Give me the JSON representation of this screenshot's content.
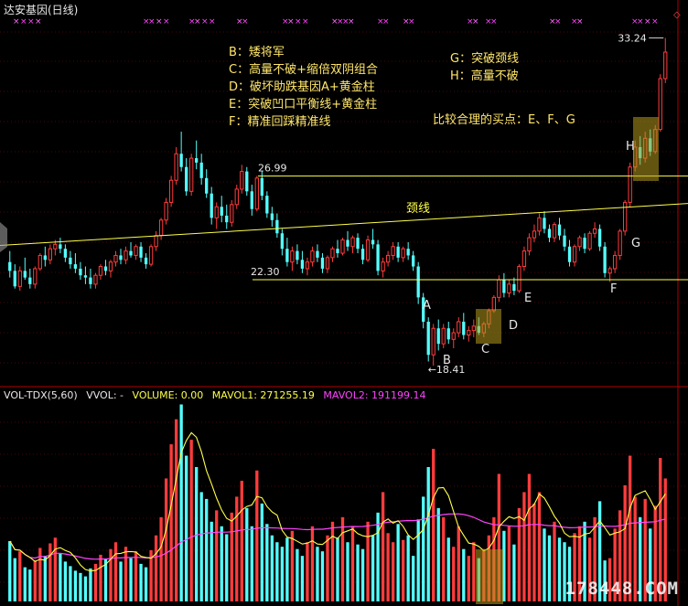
{
  "title": "达安基因(日线)",
  "legend": {
    "left": [
      "B：矮将军",
      "C：高量不破+缩倍双阴组合",
      "D：破坏助跌基因A+黄金柱",
      "E：突破凹口平衡线+黄金柱",
      "F：精准回踩精准线"
    ],
    "right": [
      "G：突破颈线",
      "H：高量不破"
    ],
    "conclusion": "比较合理的买点：E、F、G"
  },
  "volume_header": {
    "indicator": "VOL-TDX(5,60)",
    "vvol": "VVOL: -",
    "volume": "VOLUME: 0.00",
    "mavol1": "MAVOL1: 271255.19",
    "mavol2": "MAVOL2: 191199.14"
  },
  "watermark": "178448.COM",
  "colors": {
    "up": "#ff3c3c",
    "down": "#54ffff",
    "line_yellow": "#ffff4a",
    "ma_magenta": "#ff44ff",
    "grid": "#8a1010",
    "text": "#e8e8e8"
  },
  "chart_data": [
    {
      "type": "candlestick",
      "y_range": [
        18.41,
        33.24
      ],
      "price_labels": {
        "high": "33.24",
        "low": "←18.41"
      },
      "horizontal_lines": [
        {
          "label": "26.99",
          "value": 26.99
        },
        {
          "label": "22.30",
          "value": 22.3
        }
      ],
      "neckline": {
        "label": "颈线",
        "start_value": 23.85,
        "end_value": 25.75
      },
      "point_labels": [
        "A",
        "B",
        "C",
        "D",
        "E",
        "F",
        "G",
        "H"
      ],
      "candles": [
        [
          23.1,
          23.6,
          22.4,
          22.7
        ],
        [
          22.7,
          23.0,
          21.9,
          22.0
        ],
        [
          22.0,
          22.9,
          21.8,
          22.7
        ],
        [
          22.7,
          23.3,
          22.3,
          22.4
        ],
        [
          22.4,
          22.8,
          21.9,
          22.1
        ],
        [
          22.1,
          22.9,
          21.9,
          22.8
        ],
        [
          22.8,
          23.5,
          22.7,
          23.4
        ],
        [
          23.4,
          23.8,
          22.9,
          23.2
        ],
        [
          23.2,
          23.9,
          23.0,
          23.7
        ],
        [
          23.7,
          24.1,
          23.4,
          23.9
        ],
        [
          23.9,
          24.2,
          23.5,
          23.7
        ],
        [
          23.7,
          23.9,
          23.1,
          23.3
        ],
        [
          23.3,
          23.6,
          22.8,
          23.0
        ],
        [
          23.0,
          23.5,
          22.6,
          22.8
        ],
        [
          22.8,
          23.1,
          22.3,
          22.5
        ],
        [
          22.5,
          22.9,
          22.1,
          22.4
        ],
        [
          22.4,
          22.8,
          21.9,
          22.1
        ],
        [
          22.1,
          22.6,
          21.9,
          22.5
        ],
        [
          22.5,
          23.0,
          22.3,
          22.9
        ],
        [
          22.9,
          23.2,
          22.5,
          22.7
        ],
        [
          22.7,
          23.2,
          22.4,
          23.1
        ],
        [
          23.1,
          23.6,
          22.9,
          23.4
        ],
        [
          23.4,
          23.7,
          23.0,
          23.2
        ],
        [
          23.2,
          23.8,
          23.0,
          23.6
        ],
        [
          23.6,
          24.0,
          23.3,
          23.4
        ],
        [
          23.4,
          23.9,
          23.2,
          23.8
        ],
        [
          23.8,
          24.0,
          23.1,
          23.3
        ],
        [
          23.3,
          23.5,
          22.8,
          23.0
        ],
        [
          23.0,
          23.9,
          22.9,
          23.8
        ],
        [
          23.8,
          24.5,
          23.6,
          24.3
        ],
        [
          24.3,
          25.1,
          24.1,
          25.0
        ],
        [
          25.0,
          26.0,
          24.8,
          25.8
        ],
        [
          25.8,
          27.0,
          25.6,
          26.8
        ],
        [
          26.8,
          28.3,
          26.6,
          28.0
        ],
        [
          28.0,
          29.0,
          27.2,
          27.4
        ],
        [
          27.4,
          27.8,
          26.1,
          26.3
        ],
        [
          26.3,
          28.0,
          26.1,
          27.8
        ],
        [
          27.8,
          28.6,
          27.3,
          27.6
        ],
        [
          27.6,
          28.0,
          26.6,
          26.9
        ],
        [
          26.9,
          27.3,
          26.0,
          26.2
        ],
        [
          26.2,
          26.5,
          24.8,
          25.1
        ],
        [
          25.1,
          25.8,
          24.6,
          25.6
        ],
        [
          25.6,
          26.1,
          24.9,
          25.2
        ],
        [
          25.2,
          25.7,
          24.6,
          24.9
        ],
        [
          24.9,
          25.9,
          24.7,
          25.7
        ],
        [
          25.7,
          26.6,
          25.5,
          26.4
        ],
        [
          26.4,
          27.5,
          26.2,
          27.2
        ],
        [
          27.2,
          27.4,
          26.1,
          26.3
        ],
        [
          26.3,
          26.6,
          25.2,
          25.5
        ],
        [
          25.5,
          27.0,
          25.4,
          26.9
        ],
        [
          26.9,
          27.2,
          25.9,
          26.1
        ],
        [
          26.1,
          26.3,
          25.1,
          25.3
        ],
        [
          25.3,
          25.6,
          24.7,
          25.0
        ],
        [
          25.0,
          25.3,
          24.2,
          24.4
        ],
        [
          24.4,
          24.6,
          23.4,
          23.7
        ],
        [
          23.7,
          24.2,
          22.9,
          23.1
        ],
        [
          23.1,
          23.8,
          22.7,
          23.6
        ],
        [
          23.6,
          23.9,
          23.0,
          23.2
        ],
        [
          23.2,
          23.6,
          22.6,
          22.8
        ],
        [
          22.8,
          23.3,
          22.5,
          23.1
        ],
        [
          23.1,
          23.8,
          22.9,
          23.6
        ],
        [
          23.6,
          23.9,
          23.1,
          23.3
        ],
        [
          23.3,
          23.5,
          22.6,
          22.8
        ],
        [
          22.8,
          23.4,
          22.6,
          23.3
        ],
        [
          23.3,
          23.8,
          23.1,
          23.7
        ],
        [
          23.7,
          24.1,
          23.3,
          23.5
        ],
        [
          23.5,
          24.2,
          23.4,
          24.1
        ],
        [
          24.1,
          24.5,
          23.6,
          23.8
        ],
        [
          23.8,
          24.3,
          23.5,
          24.2
        ],
        [
          24.2,
          24.4,
          23.5,
          23.7
        ],
        [
          23.7,
          23.9,
          23.0,
          23.2
        ],
        [
          23.2,
          24.3,
          23.1,
          24.1
        ],
        [
          24.1,
          24.6,
          23.7,
          23.9
        ],
        [
          23.9,
          24.1,
          22.5,
          22.7
        ],
        [
          22.7,
          23.3,
          22.4,
          23.1
        ],
        [
          23.1,
          23.6,
          22.9,
          23.4
        ],
        [
          23.4,
          24.0,
          23.2,
          23.8
        ],
        [
          23.8,
          24.0,
          23.1,
          23.3
        ],
        [
          23.3,
          23.8,
          23.1,
          23.7
        ],
        [
          23.7,
          24.0,
          23.2,
          23.4
        ],
        [
          23.4,
          23.6,
          22.7,
          22.9
        ],
        [
          22.9,
          23.1,
          21.2,
          21.5
        ],
        [
          21.5,
          21.7,
          20.1,
          20.4
        ],
        [
          20.4,
          20.6,
          18.6,
          18.9
        ],
        [
          18.9,
          20.3,
          18.41,
          20.1
        ],
        [
          20.1,
          20.5,
          19.1,
          19.4
        ],
        [
          19.4,
          20.3,
          19.2,
          20.1
        ],
        [
          20.1,
          20.4,
          19.4,
          19.6
        ],
        [
          19.6,
          20.1,
          19.2,
          19.9
        ],
        [
          19.9,
          20.6,
          19.7,
          20.4
        ],
        [
          20.4,
          20.8,
          19.6,
          19.8
        ],
        [
          19.8,
          20.2,
          19.5,
          20.0
        ],
        [
          20.0,
          20.5,
          19.7,
          20.2
        ],
        [
          20.2,
          20.6,
          19.8,
          19.9
        ],
        [
          19.9,
          20.4,
          19.7,
          20.3
        ],
        [
          20.3,
          21.0,
          20.1,
          20.9
        ],
        [
          20.9,
          21.6,
          20.8,
          21.5
        ],
        [
          21.5,
          22.5,
          21.3,
          22.3
        ],
        [
          22.3,
          22.6,
          21.5,
          21.7
        ],
        [
          21.7,
          22.3,
          21.5,
          22.1
        ],
        [
          22.1,
          22.4,
          21.6,
          21.8
        ],
        [
          21.8,
          23.0,
          21.7,
          22.9
        ],
        [
          22.9,
          23.8,
          22.7,
          23.6
        ],
        [
          23.6,
          24.4,
          23.4,
          24.2
        ],
        [
          24.2,
          24.8,
          24.0,
          24.5
        ],
        [
          24.5,
          25.3,
          24.3,
          25.1
        ],
        [
          25.1,
          25.4,
          24.4,
          24.6
        ],
        [
          24.6,
          24.8,
          24.0,
          24.2
        ],
        [
          24.2,
          24.9,
          24.0,
          24.8
        ],
        [
          24.8,
          25.1,
          24.1,
          24.3
        ],
        [
          24.3,
          24.6,
          23.6,
          23.8
        ],
        [
          23.8,
          24.1,
          22.9,
          23.1
        ],
        [
          23.1,
          23.9,
          22.9,
          23.8
        ],
        [
          23.8,
          24.3,
          23.6,
          24.2
        ],
        [
          24.2,
          24.4,
          23.5,
          23.7
        ],
        [
          23.7,
          24.5,
          23.6,
          24.4
        ],
        [
          24.4,
          24.9,
          24.2,
          24.6
        ],
        [
          24.6,
          24.8,
          23.6,
          23.8
        ],
        [
          23.8,
          24.0,
          22.4,
          22.6
        ],
        [
          22.6,
          22.9,
          22.2,
          22.8
        ],
        [
          22.8,
          23.6,
          22.6,
          23.4
        ],
        [
          23.4,
          24.6,
          23.2,
          24.5
        ],
        [
          24.5,
          25.9,
          24.3,
          25.8
        ],
        [
          25.8,
          27.6,
          25.6,
          27.4
        ],
        [
          27.4,
          28.6,
          27.2,
          28.3
        ],
        [
          28.3,
          28.8,
          27.5,
          27.8
        ],
        [
          27.8,
          29.0,
          27.6,
          28.7
        ],
        [
          28.7,
          29.1,
          27.9,
          28.1
        ],
        [
          28.1,
          29.3,
          28.0,
          29.1
        ],
        [
          29.1,
          31.6,
          29.0,
          31.4
        ],
        [
          31.4,
          33.24,
          31.2,
          32.6
        ]
      ],
      "volume_bars": [
        53,
        38,
        44,
        30,
        28,
        36,
        47,
        40,
        51,
        56,
        42,
        35,
        31,
        27,
        25,
        22,
        29,
        33,
        41,
        37,
        46,
        52,
        35,
        48,
        38,
        44,
        33,
        30,
        45,
        58,
        74,
        108,
        138,
        160,
        173,
        128,
        142,
        118,
        96,
        90,
        70,
        80,
        66,
        59,
        78,
        92,
        106,
        82,
        66,
        115,
        86,
        68,
        58,
        52,
        48,
        56,
        62,
        46,
        40,
        52,
        66,
        48,
        44,
        58,
        70,
        56,
        74,
        52,
        66,
        50,
        46,
        70,
        58,
        78,
        96,
        60,
        52,
        68,
        54,
        58,
        40,
        72,
        92,
        118,
        134,
        82,
        74,
        56,
        48,
        66,
        46,
        40,
        52,
        38,
        46,
        58,
        74,
        112,
        62,
        66,
        50,
        82,
        96,
        112,
        86,
        96,
        64,
        58,
        70,
        56,
        52,
        48,
        60,
        66,
        70,
        56,
        74,
        88,
        36,
        38,
        64,
        80,
        102,
        128,
        92,
        74,
        90,
        64,
        84,
        126,
        108
      ],
      "mavol1_label": "MAVOL1",
      "mavol2_label": "MAVOL2"
    }
  ]
}
